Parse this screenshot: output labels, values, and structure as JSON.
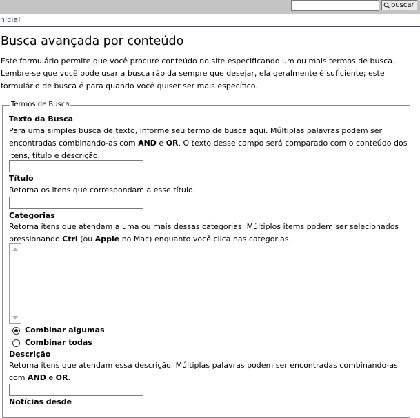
{
  "header": {
    "search_placeholder": "",
    "search_button_label": "buscar",
    "breadcrumb": "nicial"
  },
  "page": {
    "title": "Busca avançada por conteúdo",
    "intro": "Este formulário permite que você procure conteúdo no site especificando um ou mais termos de busca. Lembre-se que você pode usar a busca rápida sempre que desejar, ela geralmente é suficiente; este formulário de busca é para quando você quiser ser mais específico."
  },
  "form": {
    "legend": "Termos de Busca",
    "text": {
      "label": "Texto da Busca",
      "help_1": "Para uma simples busca de texto, informe seu termo de busca aqui. Múltiplas palavras podem ser encontradas combinando-as com ",
      "and": "AND",
      "e": " e ",
      "or": "OR",
      "help_2": ". O texto desse campo será comparado com o conteúdo dos itens, título e descrição.",
      "value": ""
    },
    "title": {
      "label": "Título",
      "help": "Retorna os itens que correspondam a esse título.",
      "value": ""
    },
    "categories": {
      "label": "Categorias",
      "help_1": "Retorna itens que atendam a uma ou mais dessas categorias. Múltiplos items podem ser selecionados pressionando ",
      "ctrl": "Ctrl",
      "help_2": " (ou ",
      "apple": "Apple",
      "help_3": " no Mac) enquanto você clica nas categorias.",
      "options": [
        {
          "label": "Combinar algumas",
          "checked": true
        },
        {
          "label": "Combinar todas",
          "checked": false
        }
      ]
    },
    "description": {
      "label": "Descrição",
      "help_1": "Retorna itens que atendam essa descrição. Múltiplas palavras podem ser encontradas combinando-as com ",
      "and": "AND",
      "e": " e ",
      "or": "OR",
      "help_2": ".",
      "value": ""
    },
    "news_since": {
      "label": "Notícias desde"
    }
  }
}
